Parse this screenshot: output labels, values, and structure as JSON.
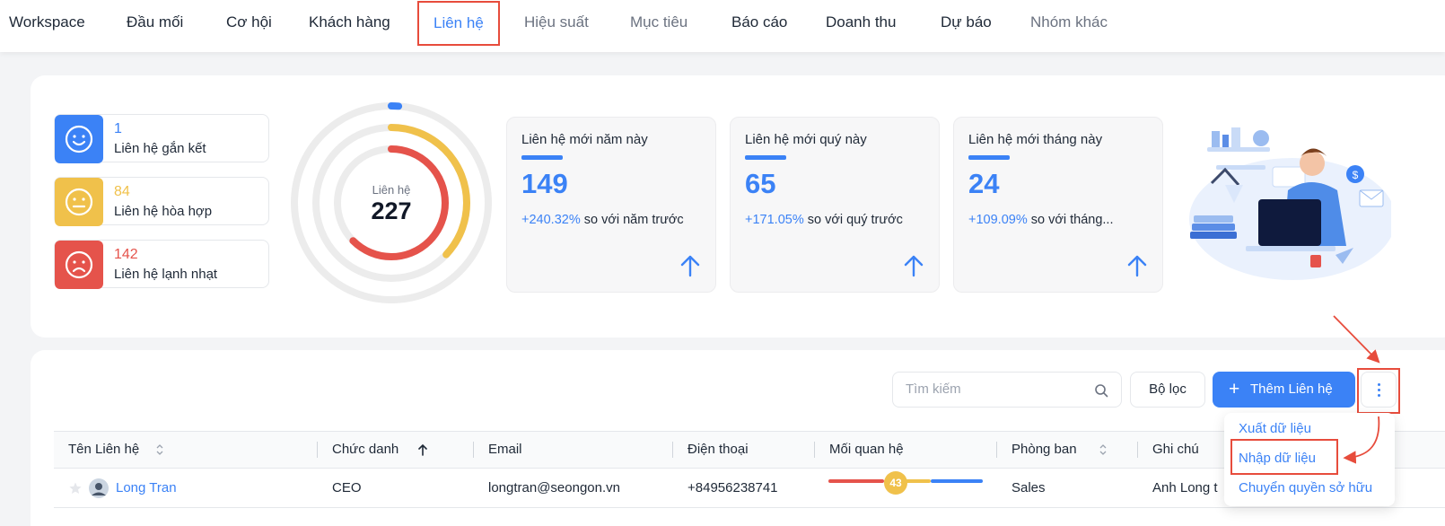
{
  "nav": {
    "items": [
      {
        "label": "Workspace",
        "state": "normal"
      },
      {
        "label": "Đầu mối",
        "state": "normal"
      },
      {
        "label": "Cơ hội",
        "state": "normal"
      },
      {
        "label": "Khách hàng",
        "state": "normal"
      },
      {
        "label": "Liên hệ",
        "state": "active"
      },
      {
        "label": "Hiệu suất",
        "state": "muted"
      },
      {
        "label": "Mục tiêu",
        "state": "muted"
      },
      {
        "label": "Báo cáo",
        "state": "normal"
      },
      {
        "label": "Doanh thu",
        "state": "normal"
      },
      {
        "label": "Dự báo",
        "state": "normal"
      },
      {
        "label": "Nhóm khác",
        "state": "muted"
      }
    ]
  },
  "relationships": [
    {
      "value": "1",
      "label": "Liên hệ gắn kết",
      "color": "#3b82f6",
      "icon": "smile-icon"
    },
    {
      "value": "84",
      "label": "Liên hệ hòa hợp",
      "color": "#f0c14b",
      "icon": "neutral-face-icon"
    },
    {
      "value": "142",
      "label": "Liên hệ lạnh nhạt",
      "color": "#e5534b",
      "icon": "sad-face-icon"
    }
  ],
  "ring": {
    "label": "Liên hệ",
    "total": "227",
    "segments": [
      {
        "name": "gắn kết",
        "value": 1,
        "color": "#3b82f6"
      },
      {
        "name": "hòa hợp",
        "value": 84,
        "color": "#f0c14b"
      },
      {
        "name": "lạnh nhạt",
        "value": 142,
        "color": "#e5534b"
      }
    ]
  },
  "kpis": [
    {
      "title": "Liên hệ mới năm này",
      "value": "149",
      "pct": "+240.32%",
      "compare": " so với năm trước"
    },
    {
      "title": "Liên hệ mới quý này",
      "value": "65",
      "pct": "+171.05%",
      "compare": " so với quý trước"
    },
    {
      "title": "Liên hệ mới tháng này",
      "value": "24",
      "pct": "+109.09%",
      "compare": " so với tháng..."
    }
  ],
  "toolbar": {
    "search_placeholder": "Tìm kiếm",
    "filter_label": "Bộ lọc",
    "add_label": "Thêm Liên hệ",
    "add_plus": "+"
  },
  "table": {
    "headers": [
      "Tên Liên hệ",
      "Chức danh",
      "Email",
      "Điện thoại",
      "Mối quan hệ",
      "Phòng ban",
      "Ghi chú"
    ],
    "row": {
      "name": "Long Tran",
      "title": "CEO",
      "email": "longtran@seongon.vn",
      "phone": "+84956238741",
      "relationship_score": "43",
      "department": "Sales",
      "note": "Anh Long t"
    }
  },
  "dropdown": {
    "items": [
      "Xuất dữ liệu",
      "Nhập dữ liệu",
      "Chuyển quyền sở hữu"
    ]
  },
  "colors": {
    "accent": "#3b82f6",
    "highlight": "#e74c3c"
  }
}
